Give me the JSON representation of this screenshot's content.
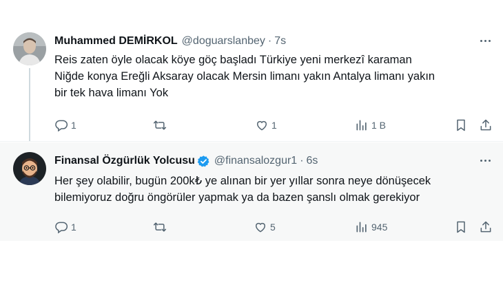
{
  "tweets": [
    {
      "name": "Muhammed DEMİRKOL",
      "handle": "@doguarslanbey",
      "separator": "·",
      "time": "7s",
      "lines": [
        "Reis zaten öyle olacak köye göç başladı Türkiye yeni merkezî karaman",
        "Niğde konya Ereğli Aksaray olacak  Mersin limanı yakın Antalya limanı yakın",
        "bir tek hava limanı Yok"
      ],
      "replies": "1",
      "retweets": "",
      "likes": "1",
      "views": "1 B"
    },
    {
      "name": "Finansal Özgürlük Yolcusu",
      "handle": "@finansalozgur1",
      "separator": "·",
      "time": "6s",
      "verified": true,
      "lines": [
        "Her şey olabilir, bugün 200k₺ ye alınan bir yer yıllar sonra neye dönüşecek",
        "bilemiyoruz doğru öngörüler yapmak ya da bazen şanslı olmak gerekiyor"
      ],
      "replies": "1",
      "retweets": "",
      "likes": "5",
      "views": "945"
    }
  ],
  "colors": {
    "text": "#0f1419",
    "secondary": "#536471",
    "verified_blue": "#1d9bf0",
    "highlight_bg": "#f7f8f8",
    "thread_line": "#cfd9de"
  },
  "icons": [
    "reply-icon",
    "retweet-icon",
    "like-icon",
    "views-icon",
    "bookmark-icon",
    "share-icon",
    "more-icon",
    "verified-badge-icon"
  ]
}
